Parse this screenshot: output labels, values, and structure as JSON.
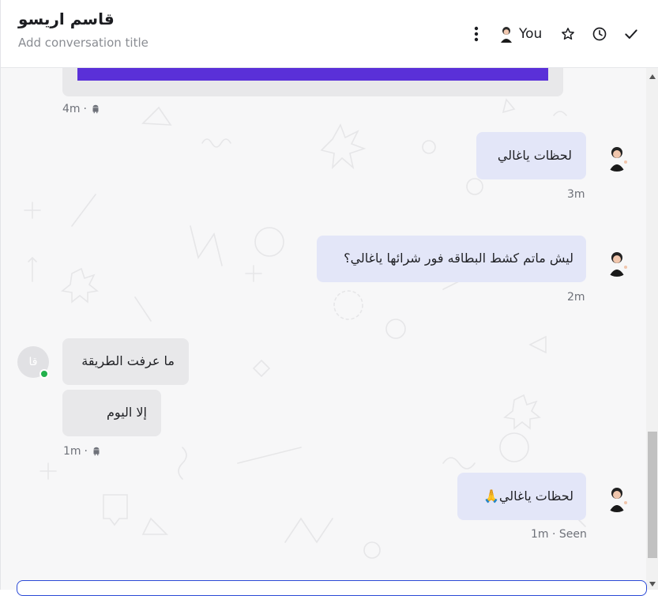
{
  "header": {
    "title": "قاسم اريسو",
    "subtitle": "Add conversation title",
    "assignee_label": "You"
  },
  "messages": [
    {
      "id": "m0",
      "side": "incoming",
      "meta": "4m",
      "device": "android-icon"
    },
    {
      "id": "m1",
      "side": "outgoing",
      "text": "لحظات ياغالي",
      "meta": "3m"
    },
    {
      "id": "m2",
      "side": "outgoing",
      "text": "ليش ماتم كشط البطاقه فور شرائها ياغالي؟",
      "meta": "2m"
    },
    {
      "id": "m3",
      "side": "incoming",
      "text": "ما عرفت الطريقة"
    },
    {
      "id": "m4",
      "side": "incoming",
      "text": "إلا اليوم",
      "meta": "1m",
      "device": "android-icon"
    },
    {
      "id": "m5",
      "side": "outgoing",
      "text": "لحظات ياغالي🙏",
      "meta": "1m · Seen"
    }
  ],
  "contact": {
    "initials": "قا"
  },
  "colors": {
    "accent": "#5a30d8",
    "incoming_bubble": "#e8e8ea",
    "outgoing_bubble": "#e3e6f8",
    "online": "#22b14c",
    "composer_border": "#2b4ad6"
  },
  "icons": {
    "more": "more-vertical-icon",
    "star": "star-icon",
    "snooze": "clock-icon",
    "resolve": "check-icon",
    "device": "android-icon"
  }
}
